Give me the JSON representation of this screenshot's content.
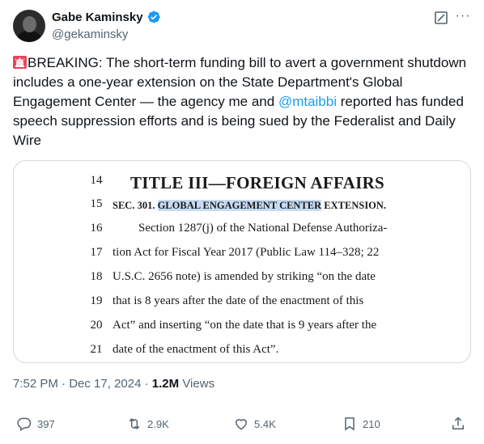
{
  "author": {
    "display_name": "Gabe Kaminsky",
    "handle": "@gekaminsky",
    "verified": true
  },
  "tweet": {
    "text_before": "BREAKING: The short-term funding bill to avert a government shutdown includes a one-year extension on the State Department's Global Engagement Center — the agency me and ",
    "mention": "@mtaibbi",
    "text_after": " reported has funded speech suppression efforts and is being sued by the Federalist and Daily Wire",
    "emoji": "rotating-light-icon"
  },
  "document": {
    "lines": [
      {
        "num": "14",
        "text": "TITLE III—FOREIGN AFFAIRS"
      },
      {
        "num": "15",
        "prefix": "SEC. 301. ",
        "highlight": "GLOBAL ENGAGEMENT CENTER",
        "suffix": " EXTENSION."
      },
      {
        "num": "16",
        "text": "Section 1287(j) of the National Defense Authoriza-"
      },
      {
        "num": "17",
        "text": "tion Act for Fiscal Year 2017 (Public Law 114–328; 22"
      },
      {
        "num": "18",
        "text": "U.S.C. 2656 note) is amended by striking “on the date"
      },
      {
        "num": "19",
        "text": "that is 8 years after the date of the enactment of this"
      },
      {
        "num": "20",
        "text": "Act” and inserting “on the date that is 9 years after the"
      },
      {
        "num": "21",
        "text": "date of the enactment of this Act”."
      }
    ]
  },
  "meta": {
    "time": "7:52 PM",
    "separator": " · ",
    "date": "Dec 17, 2024",
    "views_count": "1.2M",
    "views_label": " Views"
  },
  "actions": {
    "replies": "397",
    "reposts": "2.9K",
    "likes": "5.4K",
    "bookmarks": "210"
  },
  "colors": {
    "accent": "#1d9bf0",
    "secondary_text": "#536471",
    "highlight": "#c7dcf3"
  }
}
